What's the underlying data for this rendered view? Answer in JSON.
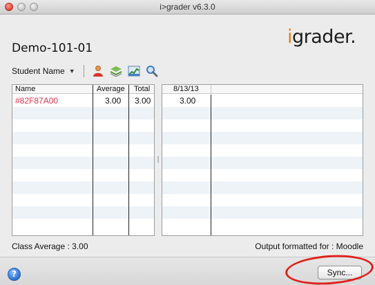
{
  "window": {
    "title": "i>grader v6.3.0"
  },
  "header": {
    "course_title": "Demo-101-01",
    "logo_prefix": "i",
    "logo_suffix": "grader."
  },
  "toolbar": {
    "sort_label": "Student Name",
    "tools": [
      {
        "icon": "student-icon"
      },
      {
        "icon": "stack-icon"
      },
      {
        "icon": "chart-icon"
      },
      {
        "icon": "search-icon"
      }
    ]
  },
  "left_table": {
    "columns": [
      "Name",
      "Average",
      "Total"
    ],
    "rows": [
      {
        "name": "#82F87A00",
        "average": "3.00",
        "total": "3.00"
      }
    ]
  },
  "right_table": {
    "columns": [
      "8/13/13"
    ],
    "rows": [
      {
        "score": "3.00"
      }
    ]
  },
  "footer": {
    "class_average": "Class Average : 3.00",
    "output_format": "Output formatted for : Moodle"
  },
  "bottom": {
    "help_label": "?",
    "sync_label": "Sync..."
  },
  "colors": {
    "student_name": "#e0344b",
    "row_alt": "#eef3f8",
    "annotation_ring": "#e0201c",
    "logo_accent": "#e87a18"
  }
}
